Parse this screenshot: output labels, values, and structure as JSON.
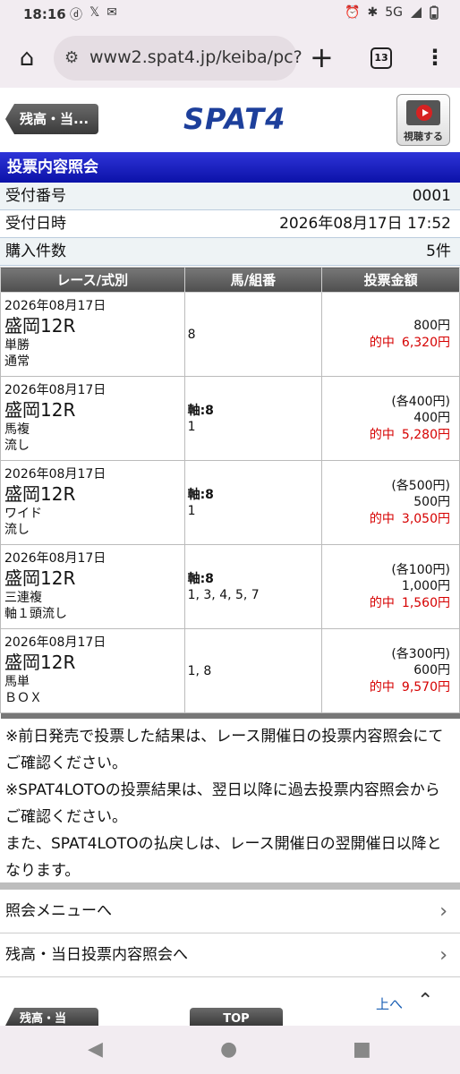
{
  "status_bar": {
    "time": "18:16",
    "left_icons": [
      "ⓓ",
      "𝕏",
      "✉"
    ],
    "network": "5G",
    "right_icons": [
      "⏰",
      "✱"
    ]
  },
  "browser": {
    "url": "www2.spat4.jp/keiba/pc?",
    "tab_count": "13"
  },
  "header": {
    "back_label": "残高・当...",
    "logo": "SPAT4",
    "watch_label": "視聴する"
  },
  "section_title": "投票内容照会",
  "info": [
    {
      "label": "受付番号",
      "value": "0001"
    },
    {
      "label": "受付日時",
      "value": "2026年08月17日 17:52"
    },
    {
      "label": "購入件数",
      "value": "5件"
    }
  ],
  "table": {
    "headers": [
      "レース/式別",
      "馬/組番",
      "投票金額"
    ],
    "rows": [
      {
        "date": "2026年08月17日",
        "race": "盛岡12R",
        "type": "単勝",
        "method": "通常",
        "axis": "",
        "combo": "8",
        "each": "",
        "amount": "800円",
        "hit_label": "的中",
        "hit_amount": "6,320円"
      },
      {
        "date": "2026年08月17日",
        "race": "盛岡12R",
        "type": "馬複",
        "method": "流し",
        "axis": "軸:8",
        "combo": "1",
        "each": "(各400円)",
        "amount": "400円",
        "hit_label": "的中",
        "hit_amount": "5,280円"
      },
      {
        "date": "2026年08月17日",
        "race": "盛岡12R",
        "type": "ワイド",
        "method": "流し",
        "axis": "軸:8",
        "combo": "1",
        "each": "(各500円)",
        "amount": "500円",
        "hit_label": "的中",
        "hit_amount": "3,050円"
      },
      {
        "date": "2026年08月17日",
        "race": "盛岡12R",
        "type": "三連複",
        "method": "軸１頭流し",
        "axis": "軸:8",
        "combo": "1, 3, 4, 5, 7",
        "each": "(各100円)",
        "amount": "1,000円",
        "hit_label": "的中",
        "hit_amount": "1,560円"
      },
      {
        "date": "2026年08月17日",
        "race": "盛岡12R",
        "type": "馬単",
        "method": "ＢＯＸ",
        "axis": "",
        "combo": "1, 8",
        "each": "(各300円)",
        "amount": "600円",
        "hit_label": "的中",
        "hit_amount": "9,570円"
      }
    ]
  },
  "notes": {
    "line1": "※前日発売で投票した結果は、レース開催日の投票内容照会にてご確認ください。",
    "line2": "※SPAT4LOTOの投票結果は、翌日以降に過去投票内容照会からご確認ください。",
    "line3": "また、SPAT4LOTOの払戻しは、レース開催日の翌開催日以降となります。"
  },
  "menu_links": [
    {
      "label": "照会メニューへ"
    },
    {
      "label": "残高・当日投票内容照会へ"
    }
  ],
  "bottom": {
    "to_top": "上へ",
    "stub_left": "残高・当",
    "stub_top": "TOP"
  }
}
